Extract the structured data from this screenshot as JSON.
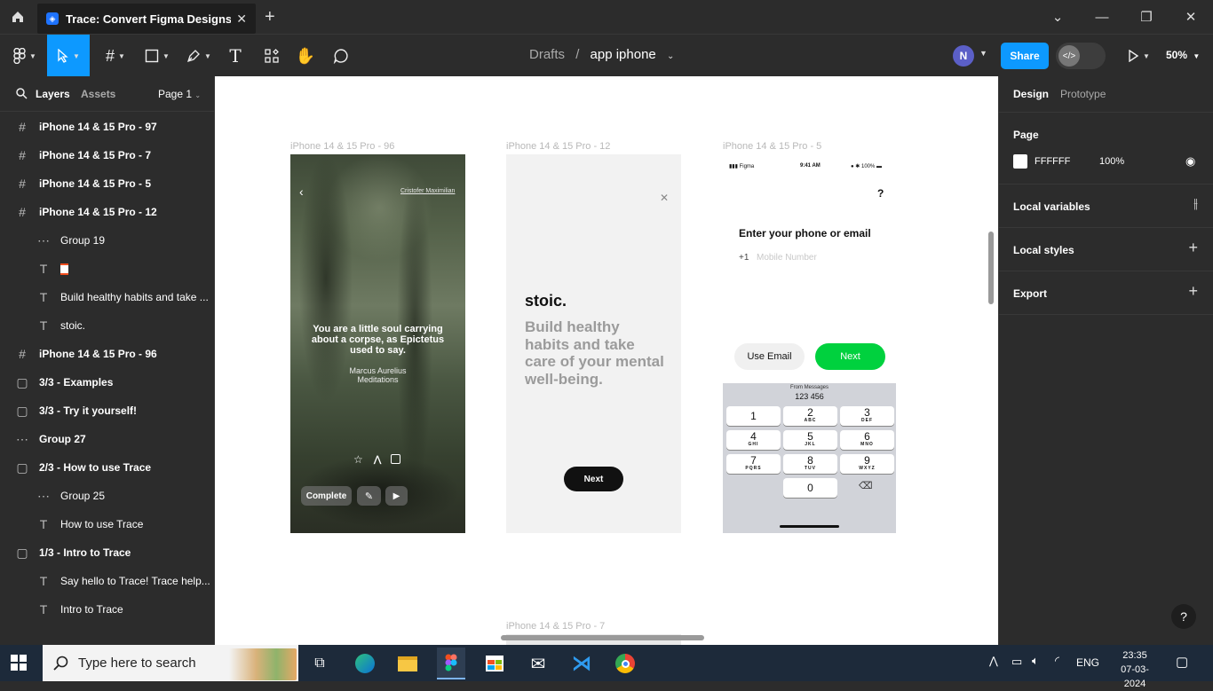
{
  "browser": {
    "tab_title": "Trace: Convert Figma Designs to S",
    "new_tab": "+"
  },
  "toolbar": {
    "breadcrumb_project": "Drafts",
    "breadcrumb_sep": "/",
    "file_name": "app iphone",
    "avatar_initial": "N",
    "share_label": "Share",
    "zoom": "50%"
  },
  "left_panel": {
    "tab_layers": "Layers",
    "tab_assets": "Assets",
    "page_selector": "Page 1",
    "layers": [
      {
        "label": "iPhone 14 & 15 Pro - 97",
        "icon": "frame"
      },
      {
        "label": "iPhone 14 & 15 Pro - 7",
        "icon": "frame"
      },
      {
        "label": "iPhone 14 & 15 Pro - 5",
        "icon": "frame"
      },
      {
        "label": "iPhone 14 & 15 Pro - 12",
        "icon": "frame"
      },
      {
        "label": "Group 19",
        "icon": "group"
      },
      {
        "label": "",
        "icon": "text"
      },
      {
        "label": "Build healthy habits and take ...",
        "icon": "text"
      },
      {
        "label": "stoic.",
        "icon": "text"
      },
      {
        "label": "iPhone 14 & 15 Pro - 96",
        "icon": "frame"
      },
      {
        "label": "3/3 - Examples",
        "icon": "section"
      },
      {
        "label": "3/3 - Try it yourself!",
        "icon": "section"
      },
      {
        "label": "Group 27",
        "icon": "group"
      },
      {
        "label": "2/3 - How to use Trace",
        "icon": "section"
      },
      {
        "label": "Group 25",
        "icon": "group"
      },
      {
        "label": "How to use Trace",
        "icon": "text"
      },
      {
        "label": "1/3 - Intro to Trace",
        "icon": "section"
      },
      {
        "label": "Say hello to Trace! Trace help...",
        "icon": "text"
      },
      {
        "label": "Intro to Trace",
        "icon": "text"
      }
    ]
  },
  "canvas": {
    "frame1": {
      "label": "iPhone 14 & 15 Pro - 96",
      "author": "Cristofer Maximilian",
      "quote": "You are a little soul carrying about a corpse, as Epictetus used to say.",
      "attribution_name": "Marcus Aurelius",
      "attribution_work": "Meditations",
      "complete_label": "Complete"
    },
    "frame2": {
      "label": "iPhone 14 & 15 Pro - 12",
      "brand": "stoic.",
      "headline": "Build healthy habits and take care of your mental well-being.",
      "next_label": "Next"
    },
    "frame3": {
      "label": "iPhone 14 & 15 Pro - 5",
      "status_carrier": "Figma",
      "status_time": "9:41 AM",
      "status_battery": "100%",
      "help_glyph": "?",
      "heading": "Enter your phone or email",
      "country_code": "+1",
      "phone_placeholder": "Mobile Number",
      "use_email_label": "Use Email",
      "next_label": "Next",
      "suggestion_title": "From Messages",
      "suggestion_value": "123 456",
      "keys": [
        {
          "digit": "1",
          "letters": ""
        },
        {
          "digit": "2",
          "letters": "ABC"
        },
        {
          "digit": "3",
          "letters": "DEF"
        },
        {
          "digit": "4",
          "letters": "GHI"
        },
        {
          "digit": "5",
          "letters": "JKL"
        },
        {
          "digit": "6",
          "letters": "MNO"
        },
        {
          "digit": "7",
          "letters": "PQRS"
        },
        {
          "digit": "8",
          "letters": "TUV"
        },
        {
          "digit": "9",
          "letters": "WXYZ"
        },
        {
          "digit": "0",
          "letters": ""
        }
      ]
    },
    "frame4_label": "iPhone 14 & 15 Pro - 7"
  },
  "right_panel": {
    "tab_design": "Design",
    "tab_prototype": "Prototype",
    "page_title": "Page",
    "page_color_hex": "FFFFFF",
    "page_opacity": "100%",
    "local_variables": "Local variables",
    "local_styles": "Local styles",
    "export": "Export",
    "help": "?"
  },
  "taskbar": {
    "search_placeholder": "Type here to search",
    "language": "ENG",
    "time": "23:35",
    "date": "07-03-2024"
  },
  "colors": {
    "figma_blue": "#0d99ff",
    "next_green": "#00d13e",
    "panel_bg": "#2c2c2c"
  }
}
